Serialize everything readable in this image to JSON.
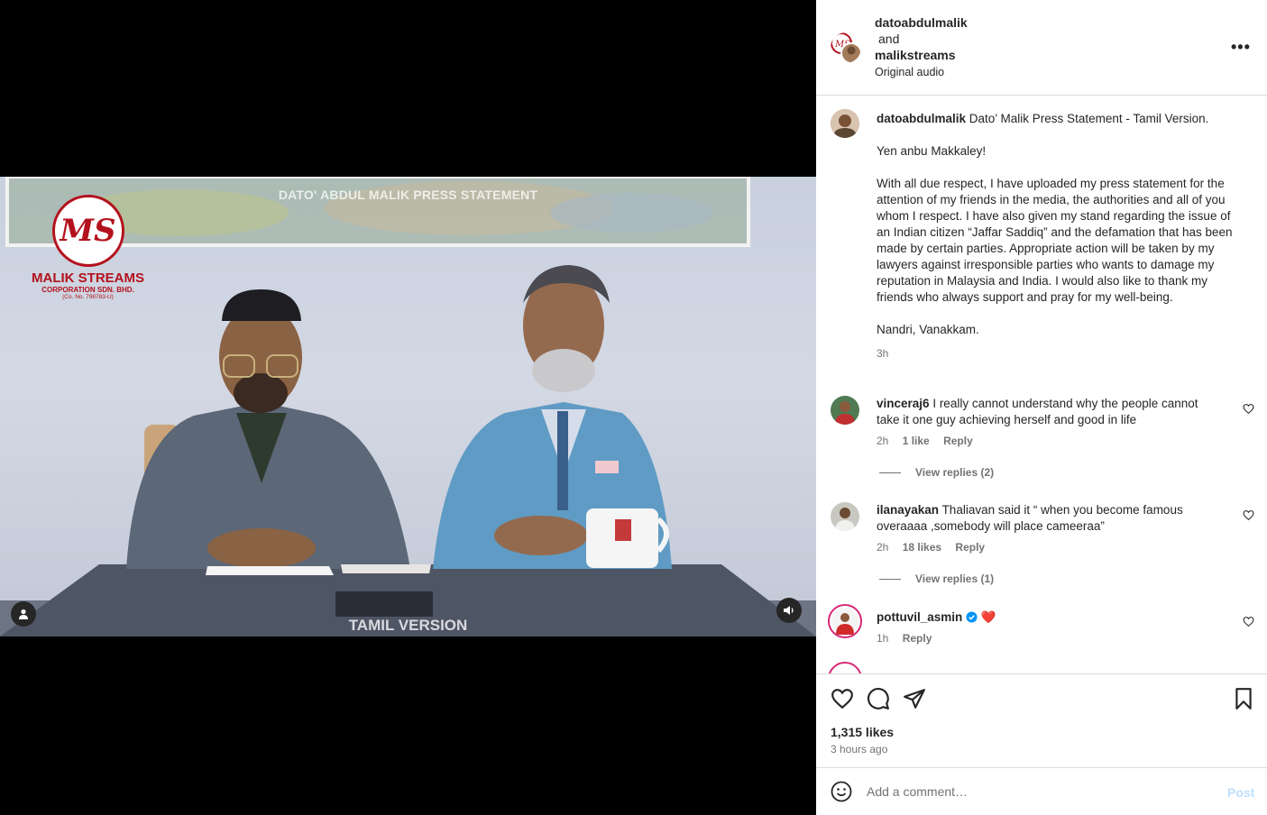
{
  "video": {
    "overlay_title": "DATO' ABDUL MALIK PRESS STATEMENT",
    "overlay_footer": "TAMIL VERSION",
    "logo": {
      "monogram": "MS",
      "name": "MALIK STREAMS",
      "corp": "CORPORATION SDN. BHD.",
      "reg": "(Co. No. 798783-U)"
    },
    "user_tag_icon": "person-icon",
    "audio_icon": "speaker-icon"
  },
  "header": {
    "user1": "datoabdulmalik",
    "and": "and",
    "user2": "malikstreams",
    "audio": "Original audio",
    "more_icon": "more-horizontal-icon",
    "more_label": "•••"
  },
  "caption": {
    "username": "datoabdulmalik",
    "title": "Dato’ Malik Press Statement - Tamil Version.",
    "greeting": "Yen anbu Makkaley!",
    "body": "With all due respect, I have uploaded my press statement for the attention of my friends in the media, the authorities and all of you whom I respect. I have also given my stand regarding the issue of an Indian citizen “Jaffar Saddiq” and the defamation that has been made by certain parties. Appropriate action will be taken by my lawyers against irresponsible parties who wants to damage my reputation in Malaysia and India. I would also like to thank my friends who always support and pray for my well-being.",
    "closing": "Nandri, Vanakkam.",
    "time": "3h"
  },
  "comments": [
    {
      "username": "vinceraj6",
      "text": "I really cannot understand why the people cannot take it one guy achieving herself and good in life",
      "time": "2h",
      "likes": "1 like",
      "reply": "Reply",
      "view_replies": "View replies (2)"
    },
    {
      "username": "ilanayakan",
      "text": "Thaliavan said it “ when you become famous overaaaa ,somebody will place cameeraa”",
      "time": "2h",
      "likes": "18 likes",
      "reply": "Reply",
      "view_replies": "View replies (1)"
    },
    {
      "username": "pottuvil_asmin",
      "text": "❤️",
      "time": "1h",
      "reply": "Reply",
      "verified": true
    }
  ],
  "actions": {
    "like_icon": "heart-icon",
    "comment_icon": "comment-icon",
    "share_icon": "share-icon",
    "save_icon": "bookmark-icon",
    "likes": "1,315 likes",
    "posted": "3 hours ago"
  },
  "add_comment": {
    "placeholder": "Add a comment…",
    "post": "Post",
    "emoji_icon": "emoji-icon"
  },
  "colors": {
    "accent_blue": "#0095f6",
    "post_disabled": "#c0dffd",
    "brand_red": "#b3121d",
    "heart_red": "#ed1c24"
  }
}
